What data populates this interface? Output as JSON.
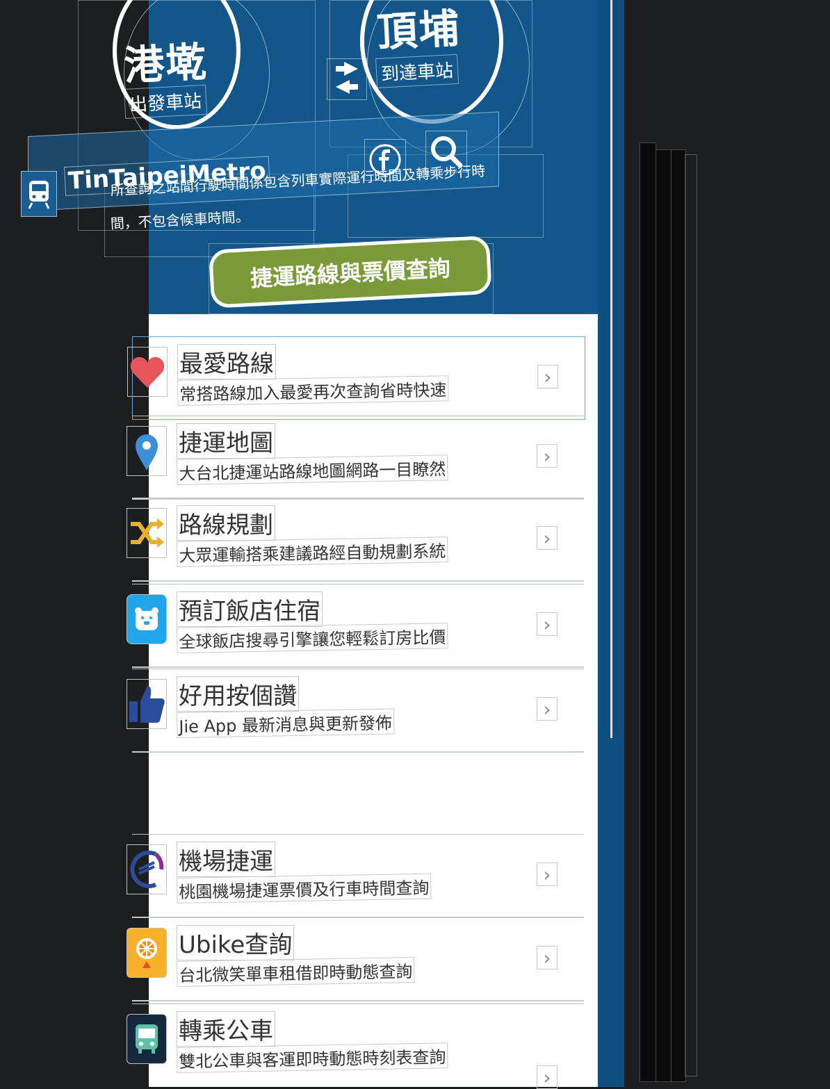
{
  "header": {
    "departure_station": "港墘",
    "departure_label": "出發車站",
    "arrival_station": "頂埔",
    "arrival_label": "到達車站",
    "app_title": "TinTaipeiMetro",
    "notice_line1": "所查詢之站間行駛時間係包含列車實際運行時間及轉乘步行時",
    "notice_line2": "間，不包含候車時間。",
    "route_button": "捷運路線與票價查詢"
  },
  "menu": [
    {
      "title": "最愛路線",
      "subtitle": "常搭路線加入最愛再次查詢省時快速",
      "icon": "heart-icon"
    },
    {
      "title": "捷運地圖",
      "subtitle": "大台北捷運站路線地圖網路一目瞭然",
      "icon": "map-pin-icon"
    },
    {
      "title": "路線規劃",
      "subtitle": "大眾運輸搭乘建議路經自動規劃系統",
      "icon": "shuffle-icon"
    },
    {
      "title": "預訂飯店住宿",
      "subtitle": "全球飯店搜尋引擎讓您輕鬆訂房比價",
      "icon": "hotel-bear-icon"
    },
    {
      "title": "好用按個讚",
      "subtitle": "Jie App 最新消息與更新發佈",
      "icon": "thumbs-up-icon"
    },
    {
      "title": "機場捷運",
      "subtitle": "桃園機場捷運票價及行車時間查詢",
      "icon": "airport-mrt-icon"
    },
    {
      "title": "Ubike查詢",
      "subtitle": "台北微笑單車租借即時動態查詢",
      "icon": "ubike-icon"
    },
    {
      "title": "轉乘公車",
      "subtitle": "雙北公車與客運即時動態時刻表查詢",
      "icon": "bus-icon"
    }
  ],
  "chevron": "›",
  "colors": {
    "header_blue": "#13568a",
    "route_green": "#7b9a3a",
    "heart_red": "#e8545c"
  }
}
